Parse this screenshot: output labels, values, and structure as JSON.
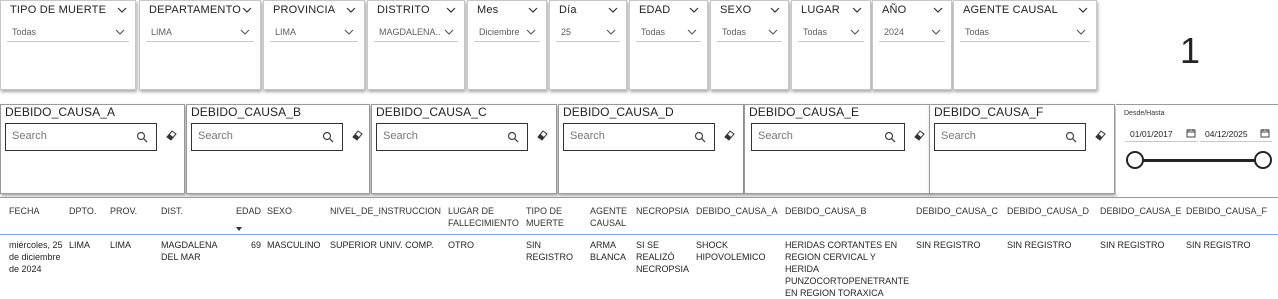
{
  "filters": [
    {
      "label": "TIPO DE MUERTE",
      "value": "Todas"
    },
    {
      "label": "DEPARTAMENTO",
      "value": "LIMA"
    },
    {
      "label": "PROVINCIA",
      "value": "LIMA"
    },
    {
      "label": "DISTRITO",
      "value": "MAGDALENA..."
    },
    {
      "label": "Mes",
      "value": "Diciembre"
    },
    {
      "label": "Día",
      "value": "25"
    },
    {
      "label": "EDAD",
      "value": "Todas"
    },
    {
      "label": "SEXO",
      "value": "Todas"
    },
    {
      "label": "LUGAR",
      "value": "Todas"
    },
    {
      "label": "AÑO",
      "value": "2024"
    },
    {
      "label": "AGENTE CAUSAL",
      "value": "Todas"
    }
  ],
  "card": {
    "value": "1"
  },
  "cause_slicers": [
    {
      "title": "DEBIDO_CAUSA_A",
      "placeholder": "Search"
    },
    {
      "title": "DEBIDO_CAUSA_B",
      "placeholder": "Search"
    },
    {
      "title": "DEBIDO_CAUSA_C",
      "placeholder": "Search"
    },
    {
      "title": "DEBIDO_CAUSA_D",
      "placeholder": "Search"
    },
    {
      "title": "DEBIDO_CAUSA_E",
      "placeholder": "Search"
    },
    {
      "title": "DEBIDO_CAUSA_F",
      "placeholder": "Search"
    }
  ],
  "date_range": {
    "label": "Desde/Hasta",
    "from": "01/01/2017",
    "to": "04/12/2025"
  },
  "table": {
    "columns": [
      "FECHA",
      "DPTO.",
      "PROV.",
      "DIST.",
      "EDAD",
      "SEXO",
      "NIVEL_DE_INSTRUCCION",
      "LUGAR DE FALLECIMIENTO",
      "TIPO DE MUERTE",
      "AGENTE CAUSAL",
      "NECROPSIA",
      "DEBIDO_CAUSA_A",
      "DEBIDO_CAUSA_B",
      "DEBIDO_CAUSA_C",
      "DEBIDO_CAUSA_D",
      "DEBIDO_CAUSA_E",
      "DEBIDO_CAUSA_F"
    ],
    "rows": [
      [
        "miércoles, 25 de diciembre de 2024",
        "LIMA",
        "LIMA",
        "MAGDALENA DEL MAR",
        "69",
        "MASCULINO",
        "SUPERIOR UNIV. COMP.",
        "OTRO",
        "SIN REGISTRO",
        "ARMA BLANCA",
        "SI SE REALIZÓ NECROPSIA",
        "SHOCK HIPOVOLEMICO",
        "HERIDAS CORTANTES EN REGION CERVICAL Y HERIDA PUNZOCORTOPENETRANTE EN REGION TORAXICA",
        "SIN REGISTRO",
        "SIN REGISTRO",
        "SIN REGISTRO",
        "SIN REGISTRO"
      ]
    ]
  }
}
